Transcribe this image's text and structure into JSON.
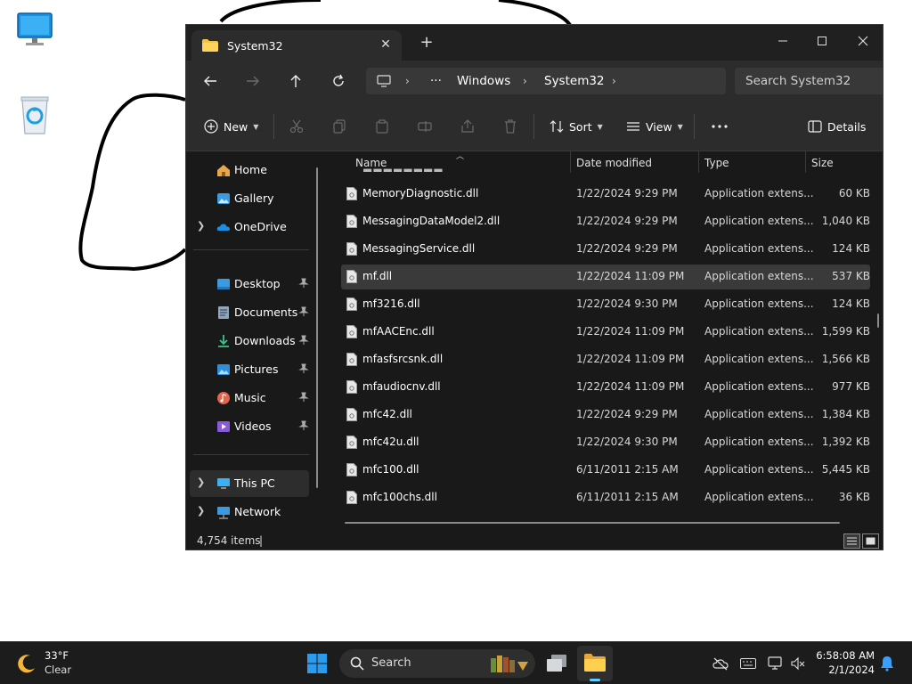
{
  "window": {
    "tab_title": "System32",
    "new_tab_label": "+",
    "tab_close_label": "✕"
  },
  "address": {
    "more": "···",
    "crumbs": [
      "Windows",
      "System32"
    ]
  },
  "search": {
    "placeholder": "Search System32"
  },
  "toolbar": {
    "new_label": "New",
    "sort_label": "Sort",
    "view_label": "View",
    "details_label": "Details"
  },
  "sidebar": {
    "items": [
      {
        "label": "Home"
      },
      {
        "label": "Gallery"
      },
      {
        "label": "OneDrive"
      },
      {
        "label": "Desktop"
      },
      {
        "label": "Documents"
      },
      {
        "label": "Downloads"
      },
      {
        "label": "Pictures"
      },
      {
        "label": "Music"
      },
      {
        "label": "Videos"
      },
      {
        "label": "This PC"
      },
      {
        "label": "Network"
      }
    ]
  },
  "columns": {
    "name": "Name",
    "date": "Date modified",
    "type": "Type",
    "size": "Size"
  },
  "files": [
    {
      "name": "MemoryDiagnostic.dll",
      "date": "1/22/2024 9:29 PM",
      "type": "Application extens...",
      "size": "60 KB"
    },
    {
      "name": "MessagingDataModel2.dll",
      "date": "1/22/2024 9:29 PM",
      "type": "Application extens...",
      "size": "1,040 KB"
    },
    {
      "name": "MessagingService.dll",
      "date": "1/22/2024 9:29 PM",
      "type": "Application extens...",
      "size": "124 KB"
    },
    {
      "name": "mf.dll",
      "date": "1/22/2024 11:09 PM",
      "type": "Application extens...",
      "size": "537 KB"
    },
    {
      "name": "mf3216.dll",
      "date": "1/22/2024 9:30 PM",
      "type": "Application extens...",
      "size": "124 KB"
    },
    {
      "name": "mfAACEnc.dll",
      "date": "1/22/2024 11:09 PM",
      "type": "Application extens...",
      "size": "1,599 KB"
    },
    {
      "name": "mfasfsrcsnk.dll",
      "date": "1/22/2024 11:09 PM",
      "type": "Application extens...",
      "size": "1,566 KB"
    },
    {
      "name": "mfaudiocnv.dll",
      "date": "1/22/2024 11:09 PM",
      "type": "Application extens...",
      "size": "977 KB"
    },
    {
      "name": "mfc42.dll",
      "date": "1/22/2024 9:29 PM",
      "type": "Application extens...",
      "size": "1,384 KB"
    },
    {
      "name": "mfc42u.dll",
      "date": "1/22/2024 9:30 PM",
      "type": "Application extens...",
      "size": "1,392 KB"
    },
    {
      "name": "mfc100.dll",
      "date": "6/11/2011 2:15 AM",
      "type": "Application extens...",
      "size": "5,445 KB"
    },
    {
      "name": "mfc100chs.dll",
      "date": "6/11/2011 2:15 AM",
      "type": "Application extens...",
      "size": "36 KB"
    }
  ],
  "selected_file": "mf.dll",
  "status": {
    "count": "4,754 items",
    "caret": "|"
  },
  "taskbar": {
    "weather_temp": "33°F",
    "weather_desc": "Clear",
    "search_label": "Search",
    "time": "6:58:08 AM",
    "date": "2/1/2024"
  },
  "colors": {
    "window_bg": "#191919",
    "toolbar_bg": "#2c2c2c",
    "selection": "#3a3a3a",
    "accent": "#0078d4",
    "folder": "#f3c443"
  }
}
